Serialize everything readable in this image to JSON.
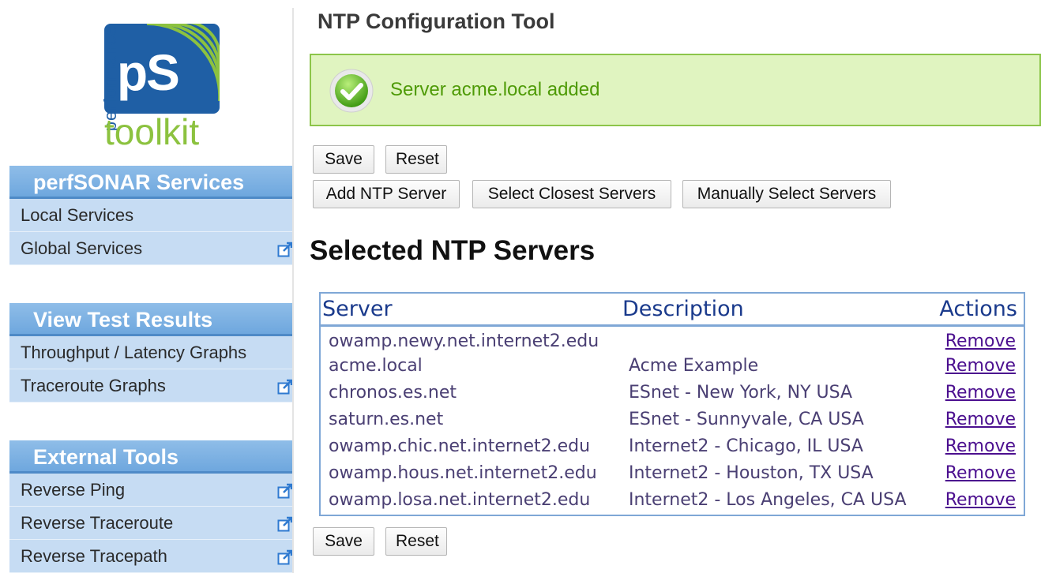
{
  "logo": {
    "ps": "pS",
    "vertical_text": "performance",
    "product": "toolkit"
  },
  "sidebar": {
    "groups": [
      {
        "title": "perfSONAR Services",
        "items": [
          {
            "label": "Local Services",
            "external": false
          },
          {
            "label": "Global Services",
            "external": true
          }
        ]
      },
      {
        "title": "View Test Results",
        "items": [
          {
            "label": "Throughput / Latency Graphs",
            "external": false
          },
          {
            "label": "Traceroute Graphs",
            "external": true
          }
        ]
      },
      {
        "title": "External Tools",
        "items": [
          {
            "label": "Reverse Ping",
            "external": true
          },
          {
            "label": "Reverse Traceroute",
            "external": true
          },
          {
            "label": "Reverse Tracepath",
            "external": true
          }
        ]
      }
    ]
  },
  "main": {
    "title": "NTP Configuration Tool",
    "success_message": "Server acme.local added",
    "buttons": {
      "save": "Save",
      "reset": "Reset",
      "add_server": "Add NTP Server",
      "select_closest": "Select Closest Servers",
      "manual_select": "Manually Select Servers"
    },
    "section_title": "Selected NTP Servers",
    "table": {
      "headers": [
        "Server",
        "Description",
        "Actions"
      ],
      "rows": [
        {
          "server": "owamp.newy.net.internet2.edu",
          "description": "",
          "action": "Remove"
        },
        {
          "server": "acme.local",
          "description": "Acme Example",
          "action": "Remove"
        },
        {
          "server": "chronos.es.net",
          "description": "ESnet - New York, NY USA",
          "action": "Remove"
        },
        {
          "server": "saturn.es.net",
          "description": "ESnet - Sunnyvale, CA USA",
          "action": "Remove"
        },
        {
          "server": "owamp.chic.net.internet2.edu",
          "description": "Internet2 - Chicago, IL USA",
          "action": "Remove"
        },
        {
          "server": "owamp.hous.net.internet2.edu",
          "description": "Internet2 - Houston, TX USA",
          "action": "Remove"
        },
        {
          "server": "owamp.losa.net.internet2.edu",
          "description": "Internet2 - Los Angeles, CA USA",
          "action": "Remove"
        }
      ]
    }
  },
  "colors": {
    "menu_header": "#6ea7de",
    "menu_item": "#c6dcf3",
    "success_bg": "#e0f4c0",
    "success_text": "#4e9a06",
    "table_border": "#7fa7d6"
  }
}
